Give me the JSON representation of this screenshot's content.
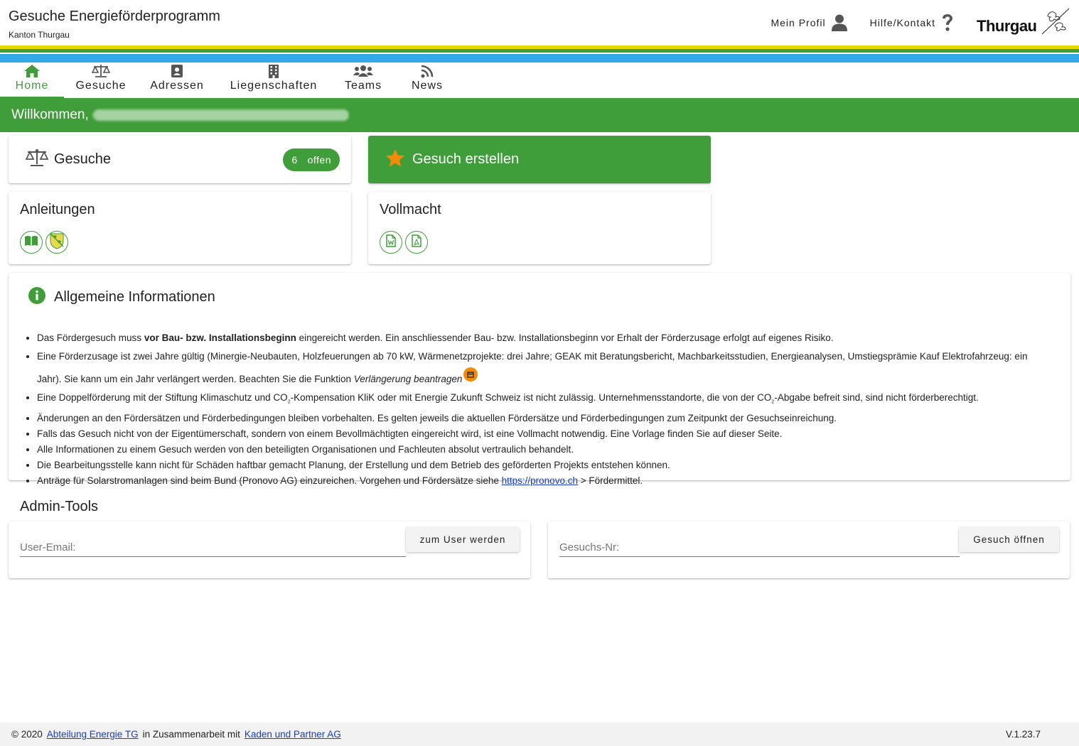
{
  "header": {
    "title": "Gesuche Energieförderprogramm",
    "subtitle": "Kanton Thurgau",
    "profile_label": "Mein Profil",
    "help_label": "Hilfe/Kontakt",
    "logo_text": "Thurgau"
  },
  "nav": {
    "items": [
      {
        "label": "Home",
        "icon": "home-icon"
      },
      {
        "label": "Gesuche",
        "icon": "scale-icon"
      },
      {
        "label": "Adressen",
        "icon": "address-book-icon"
      },
      {
        "label": "Liegenschaften",
        "icon": "building-icon"
      },
      {
        "label": "Teams",
        "icon": "users-icon"
      },
      {
        "label": "News",
        "icon": "rss-icon"
      }
    ],
    "active": "Home"
  },
  "welcome": {
    "text": "Willkommen,"
  },
  "gesuche_card": {
    "title": "Gesuche",
    "count": "6",
    "status": "offen"
  },
  "create_card": {
    "title": "Gesuch erstellen"
  },
  "anleitungen": {
    "title": "Anleitungen"
  },
  "vollmacht": {
    "title": "Vollmacht"
  },
  "info": {
    "title": "Allgemeine Informationen",
    "items": {
      "i1_pre": "Das Fördergesuch muss ",
      "i1_bold": "vor Bau- bzw. Installationsbeginn",
      "i1_post": " eingereicht werden. Ein anschliessender Bau- bzw. Installationsbeginn vor Erhalt der Förderzusage erfolgt auf eigenes Risiko.",
      "i2_pre": "Eine Förderzusage ist zwei Jahre gültig (Minergie-Neubauten, Holzfeuerungen ab 70 kW, Wärmenetzprojekte: drei Jahre; GEAK mit Beratungsbericht, Machbarkeitsstudien, Energieanalysen, Umstiegsprämie Kauf Elektrofahrzeug: ein Jahr). Sie kann um ein Jahr verlängert werden. Beachten Sie die Funktion ",
      "i2_em": "Verlängerung beantragen",
      "i3_a": "Eine Doppelförderung mit der Stiftung Klimaschutz und CO",
      "i3_sub1": "2",
      "i3_b": "-Kompensation KliK oder mit Energie Zukunft Schweiz ist nicht zulässig. Unternehmensstandorte, die von der CO",
      "i3_sub2": "2",
      "i3_c": "-Abgabe befreit sind, sind nicht förderberechtigt.",
      "i4": "Änderungen an den Fördersätzen und Förderbedingungen bleiben vorbehalten. Es gelten jeweils die aktuellen Fördersätze und Förderbedingungen zum Zeitpunkt der Gesuchseinreichung.",
      "i5": "Falls das Gesuch nicht von der Eigentümerschaft, sondern von einem Bevollmächtigten eingereicht wird, ist eine Vollmacht notwendig. Eine Vorlage finden Sie auf dieser Seite.",
      "i6": "Alle Informationen zu einem Gesuch werden von den beteiligten Organisationen und Fachleuten absolut vertraulich behandelt.",
      "i7": "Die Bearbeitungsstelle kann nicht für Schäden haftbar gemacht Planung, der Erstellung und dem Betrieb des geförderten Projekts entstehen können.",
      "i8_pre": "Anträge für Solarstromanlagen sind beim Bund (Pronovo AG) einzureichen. Vorgehen und Fördersätze siehe ",
      "i8_link": "https://pronovo.ch",
      "i8_post": " > Fördermittel."
    }
  },
  "admin": {
    "title": "Admin-Tools",
    "email_placeholder": "User-Email:",
    "become_user_label": "zum User werden",
    "gesuch_placeholder": "Gesuchs-Nr:",
    "open_gesuch_label": "Gesuch öffnen"
  },
  "footer": {
    "copyright": "© 2020",
    "link1": "Abteilung Energie TG",
    "mid": "in Zusammenarbeit mit",
    "link2": "Kaden und Partner AG",
    "version": "V.1.23.7"
  },
  "colors": {
    "primary": "#3f9e39",
    "accent": "#f58a07",
    "stripe_yellow": "#e3d800",
    "stripe_blue": "#33a9e8"
  }
}
